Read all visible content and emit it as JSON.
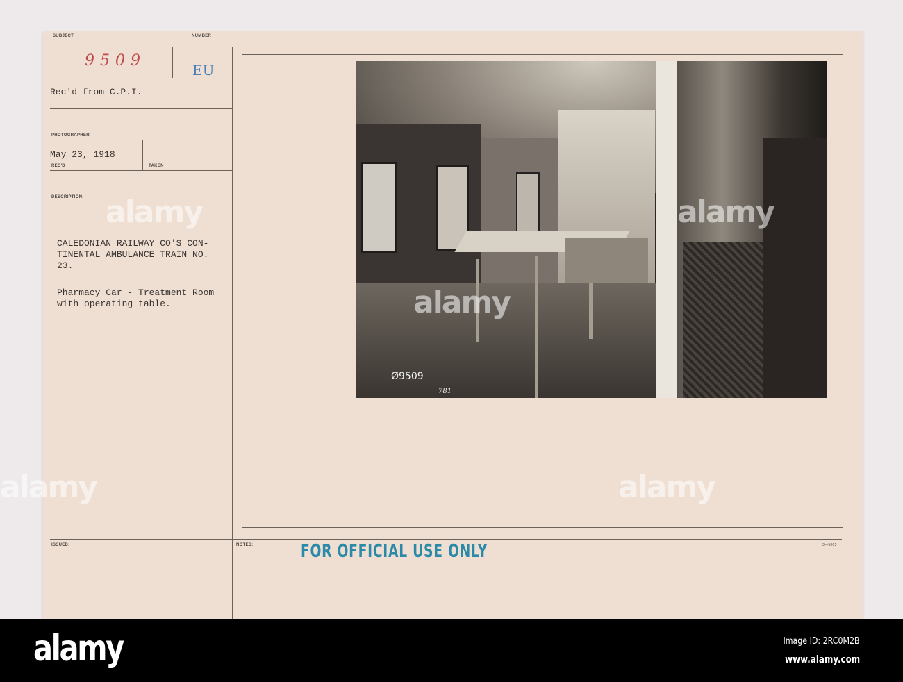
{
  "card": {
    "subject_label": "SUBJECT:",
    "subject_value": "9509",
    "number_label": "NUMBER",
    "number_value": "EU",
    "received_from": "Rec'd from C.P.I.",
    "photographer_label": "PHOTOGRAPHER",
    "date": "May 23, 1918",
    "recd_label": "REC'D",
    "taken_label": "TAKEN",
    "description_label": "DESCRIPTION:",
    "description_lines": [
      "CALEDONIAN RAILWAY CO'S CON-",
      "TINENTAL AMBULANCE TRAIN NO.",
      "23."
    ],
    "caption_lines": [
      "Pharmacy Car - Treatment Room",
      "with operating table."
    ],
    "issued_label": "ISSUED:",
    "notes_label": "NOTES:",
    "stamp": "FOR OFFICIAL USE ONLY",
    "form_number": "3—5005"
  },
  "photo": {
    "negative_number": "Ø9509",
    "plate_number": "781"
  },
  "watermark": {
    "text": "alamy",
    "image_id": "Image ID: 2RC0M2B",
    "url": "www.alamy.com"
  }
}
